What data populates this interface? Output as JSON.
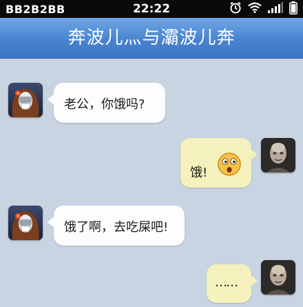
{
  "status_bar": {
    "carrier": "BB2B2BB",
    "time": "22:22",
    "icons": [
      "alarm-icon",
      "wifi-icon",
      "signal-icon",
      "battery-icon"
    ]
  },
  "chat_title": "奔波儿灬与灞波儿奔",
  "colors": {
    "title_bar": "#4983cf",
    "background": "#c9d4e3",
    "incoming_bubble": "#fdfdfd",
    "outgoing_bubble": "#f4f1bd"
  },
  "messages": [
    {
      "side": "incoming",
      "text": "老公，你饿吗?"
    },
    {
      "side": "outgoing",
      "text": "饿!",
      "emoji": "curious-face-emoji"
    },
    {
      "side": "incoming",
      "text": "饿了啊，去吃屎吧!"
    },
    {
      "side": "outgoing",
      "text": "……"
    }
  ]
}
